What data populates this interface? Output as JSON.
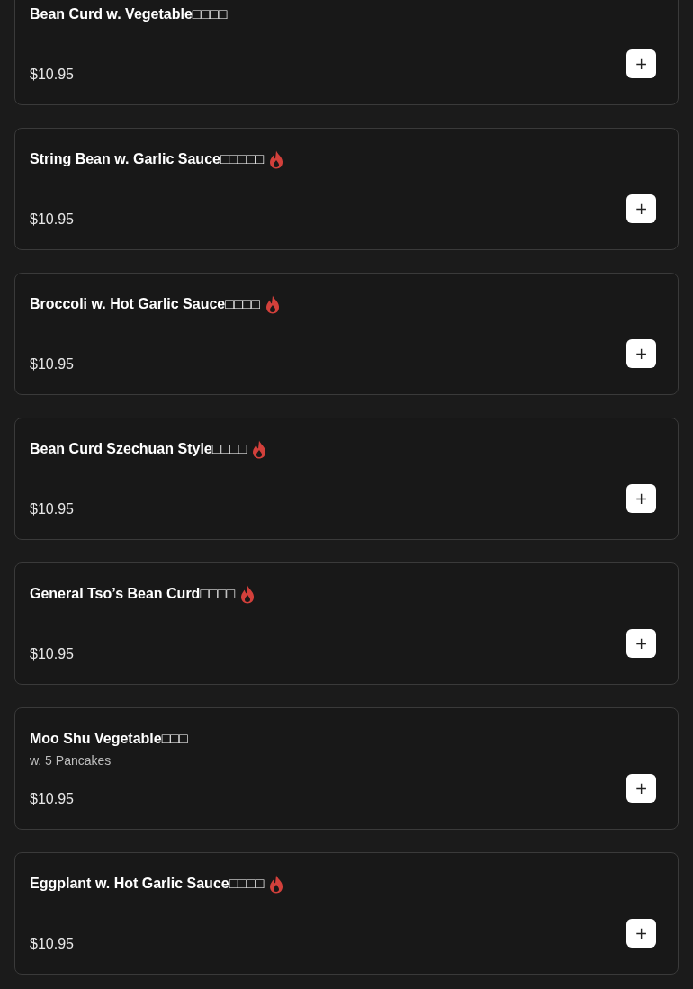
{
  "items": [
    {
      "name": "Bean Curd w. Vegetable□□□□",
      "spicy": false,
      "price": "$10.95",
      "add": "+"
    },
    {
      "name": "String Bean w. Garlic Sauce□□□□□",
      "spicy": true,
      "price": "$10.95",
      "add": "+"
    },
    {
      "name": "Broccoli w. Hot Garlic Sauce□□□□",
      "spicy": true,
      "price": "$10.95",
      "add": "+"
    },
    {
      "name": "Bean Curd Szechuan Style□□□□",
      "spicy": true,
      "price": "$10.95",
      "add": "+"
    },
    {
      "name": "General Tso’s Bean Curd□□□□",
      "spicy": true,
      "price": "$10.95",
      "add": "+"
    },
    {
      "name": "Moo Shu Vegetable□□□",
      "spicy": false,
      "description": "w. 5 Pancakes",
      "price": "$10.95",
      "add": "+"
    },
    {
      "name": "Eggplant w. Hot Garlic Sauce□□□□",
      "spicy": true,
      "price": "$10.95",
      "add": "+"
    }
  ]
}
